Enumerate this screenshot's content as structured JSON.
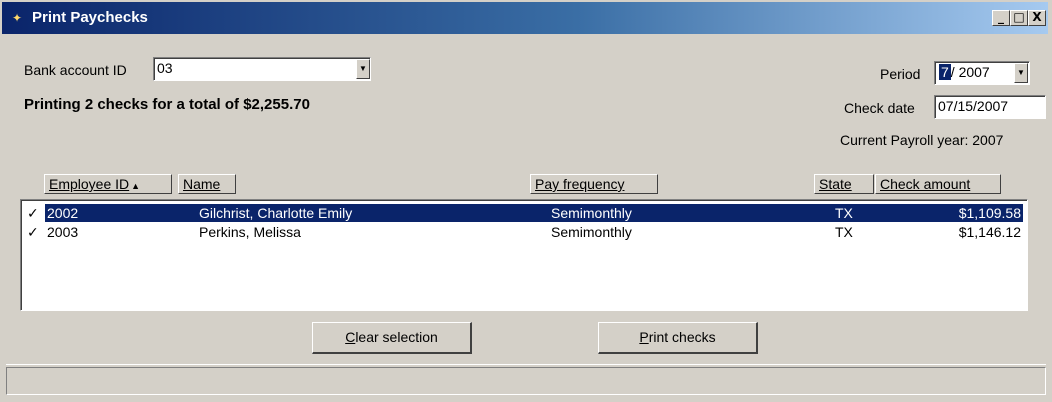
{
  "window": {
    "title": "Print Paychecks",
    "controls": {
      "minimize": "_",
      "maximize": "□",
      "close": "X"
    }
  },
  "bank_account": {
    "label": "Bank account ID",
    "value": "03"
  },
  "summary": "Printing 2 checks for a total of $2,255.70",
  "period": {
    "label": "Period",
    "month": "7",
    "separator": "/",
    "year": "2007"
  },
  "check_date": {
    "label": "Check date",
    "value": "07/15/2007"
  },
  "payroll_year": "Current Payroll year: 2007",
  "columns": {
    "employee_id": "Employee ID",
    "name": "Name",
    "pay_frequency": "Pay frequency",
    "state": "State",
    "check_amount": "Check amount"
  },
  "rows": [
    {
      "check": "✓",
      "employee_id": "2002",
      "name": "Gilchrist, Charlotte Emily",
      "pay_frequency": "Semimonthly",
      "state": "TX",
      "check_amount": "$1,109.58",
      "selected": true
    },
    {
      "check": "✓",
      "employee_id": "2003",
      "name": "Perkins, Melissa",
      "pay_frequency": "Semimonthly",
      "state": "TX",
      "check_amount": "$1,146.12",
      "selected": false
    }
  ],
  "buttons": {
    "clear_selection": "Clear selection",
    "print_checks": "Print checks"
  },
  "colors": {
    "selection": "#0a246a",
    "window_face": "#d4d0c8",
    "title_gradient_start": "#0a246a"
  }
}
